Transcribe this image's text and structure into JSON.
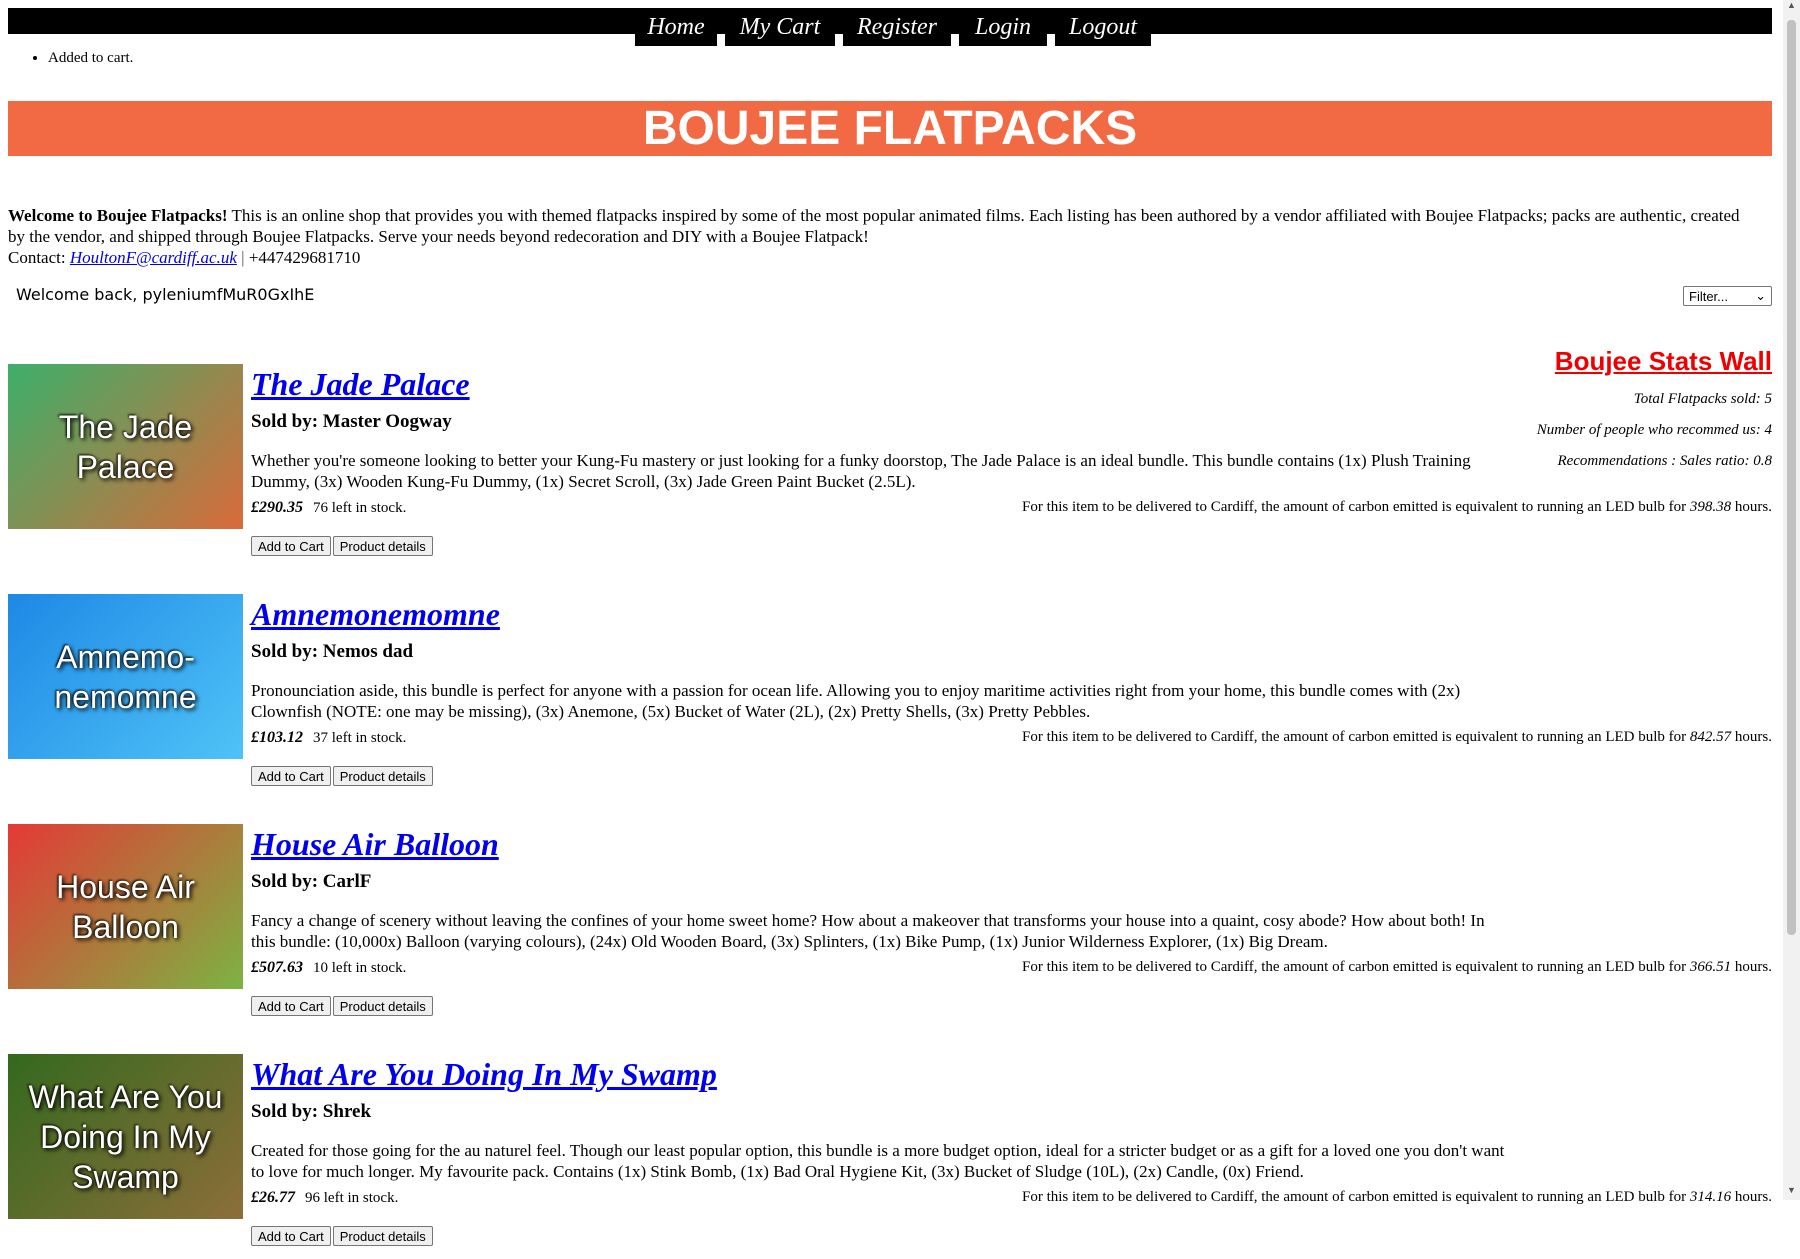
{
  "nav": [
    {
      "label": "Home",
      "cls": "home"
    },
    {
      "label": "My Cart",
      "cls": "cart"
    },
    {
      "label": "Register",
      "cls": "reg"
    },
    {
      "label": "Login",
      "cls": "login"
    },
    {
      "label": "Logout",
      "cls": "logout"
    }
  ],
  "flash": "Added to cart.",
  "banner": "BOUJEE FLATPACKS",
  "intro": {
    "bold": "Welcome to Boujee Flatpacks!",
    "text": " This is an online shop that provides you with themed flatpacks inspired by some of the most popular animated films. Each listing has been authored by a vendor affiliated with Boujee Flatpacks; packs are authentic, created by the vendor, and shipped through Boujee Flatpacks. Serve your needs beyond redecoration and DIY with a Boujee Flatpack!",
    "contact_label": "Contact: ",
    "email": "HoultonF@cardiff.ac.uk",
    "sep": " | ",
    "phone": "+447429681710"
  },
  "welcome": "Welcome back, pyleniumfMuR0GxIhE",
  "filter": {
    "label": "Filter...",
    "icon": "chevron-down-icon"
  },
  "stats": {
    "title": "Boujee Stats Wall",
    "lines": [
      "Total Flatpacks sold: 5",
      "Number of people who recommed us: 4",
      "Recommendations : Sales ratio: 0.8"
    ]
  },
  "carbon_prefix": "For this item to be delivered to Cardiff, the amount of carbon emitted is equivalent to running an LED bulb for ",
  "carbon_suffix": " hours.",
  "buttons": {
    "add": "Add to Cart",
    "details": "Product details"
  },
  "products": [
    {
      "image_text": "The Jade Palace",
      "colors": [
        "#3cb06a",
        "#d96a3a"
      ],
      "title": "The Jade Palace",
      "seller": "Sold by: Master Oogway",
      "desc": "Whether you're someone looking to better your Kung-Fu mastery or just looking for a funky doorstop, The Jade Palace is an ideal bundle. This bundle contains (1x) Plush Training Dummy, (3x) Wooden Kung-Fu Dummy, (1x) Secret Scroll, (3x) Jade Green Paint Bucket (2.5L).",
      "price": "£290.35",
      "stock": "76 left in stock.",
      "hours": "398.38"
    },
    {
      "image_text": "Amnemo-nemomne",
      "colors": [
        "#1e88e5",
        "#4fc3f7"
      ],
      "title": "Amnemonemomne",
      "seller": "Sold by: Nemos dad",
      "desc": "Pronounciation aside, this bundle is perfect for anyone with a passion for ocean life. Allowing you to enjoy maritime activities right from your home, this bundle comes with (2x) Clownfish (NOTE: one may be missing), (3x) Anemone, (5x) Bucket of Water (2L), (2x) Pretty Shells, (3x) Pretty Pebbles.",
      "price": "£103.12",
      "stock": "37 left in stock.",
      "hours": "842.57"
    },
    {
      "image_text": "House Air Balloon",
      "colors": [
        "#e53935",
        "#7cb342"
      ],
      "title": "House Air Balloon",
      "seller": "Sold by: CarlF",
      "desc": "Fancy a change of scenery without leaving the confines of your home sweet home? How about a makeover that transforms your house into a quaint, cosy abode? How about both! In this bundle: (10,000x) Balloon (varying colours), (24x) Old Wooden Board, (3x) Splinters, (1x) Bike Pump, (1x) Junior Wilderness Explorer, (1x) Big Dream.",
      "price": "£507.63",
      "stock": "10 left in stock.",
      "hours": "366.51"
    },
    {
      "image_text": "What Are You Doing In My Swamp",
      "colors": [
        "#33691e",
        "#8d6e3a"
      ],
      "title": "What Are You Doing In My Swamp",
      "seller": "Sold by: Shrek",
      "desc": "Created for those going for the au naturel feel. Though our least popular option, this bundle is a more budget option, ideal for a stricter budget or as a gift for a loved one you don't want to love for much longer. My favourite pack. Contains (1x) Stink Bomb, (1x) Bad Oral Hygiene Kit, (3x) Bucket of Sludge (10L), (2x) Candle, (0x) Friend.",
      "price": "£26.77",
      "stock": "96 left in stock.",
      "hours": "314.16"
    }
  ]
}
